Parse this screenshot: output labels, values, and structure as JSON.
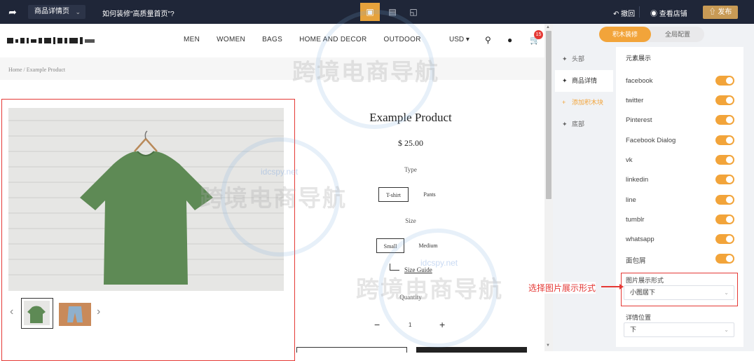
{
  "topbar": {
    "page_select": "商品详情页",
    "help_link": "如何装修\"高质量首页\"?",
    "undo": "撤回",
    "view_store": "查看店铺",
    "publish": "发布"
  },
  "store": {
    "nav": [
      "MEN",
      "WOMEN",
      "BAGS",
      "HOME AND DECOR",
      "OUTDOOR"
    ],
    "currency": "USD",
    "cart_count": "15",
    "breadcrumb": "Home  /  Example Product"
  },
  "product": {
    "title": "Example Product",
    "price": "$ 25.00",
    "type_label": "Type",
    "type_options": [
      "T-shirt",
      "Pants"
    ],
    "size_label": "Size",
    "size_options": [
      "Small",
      "Medium"
    ],
    "size_guide": "Size Guide",
    "quantity_label": "Quantity",
    "quantity": "1",
    "colors": {
      "shirt": "#5e8a55",
      "wall": "#e4e4e2"
    }
  },
  "panel": {
    "mode_tabs": [
      "积木装修",
      "全局配置"
    ],
    "side_tabs": [
      "头部",
      "商品详情",
      "添加积木块",
      "底部"
    ],
    "section_title": "元素展示",
    "toggles": [
      "facebook",
      "twitter",
      "Pinterest",
      "Facebook Dialog",
      "vk",
      "linkedin",
      "line",
      "tumblr",
      "whatsapp",
      "面包屑"
    ],
    "image_display_label": "图片展示形式",
    "image_display_value": "小图居下",
    "detail_position_label": "详情位置",
    "detail_position_value": "下",
    "accent": "#f2a43a"
  },
  "annotation": "选择图片展示形式",
  "watermark": {
    "text": "跨境电商导航",
    "site": "idcspy.net"
  }
}
